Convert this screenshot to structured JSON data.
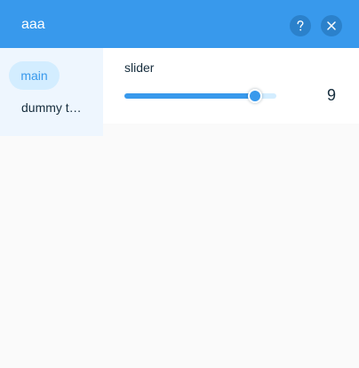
{
  "header": {
    "title": "aaa",
    "help_icon": "question-mark-icon",
    "close_icon": "close-icon"
  },
  "sidebar": {
    "items": [
      {
        "label": "main",
        "active": true
      },
      {
        "label": "dummy t…",
        "active": false
      }
    ]
  },
  "slider": {
    "label": "slider",
    "value": "9",
    "fill_fraction": 0.86
  },
  "colors": {
    "accent": "#3899ec",
    "accent_dark": "#2b81cb",
    "accent_light": "#d3edff",
    "sidebar_bg": "#eef6fe",
    "text": "#162d3d"
  }
}
